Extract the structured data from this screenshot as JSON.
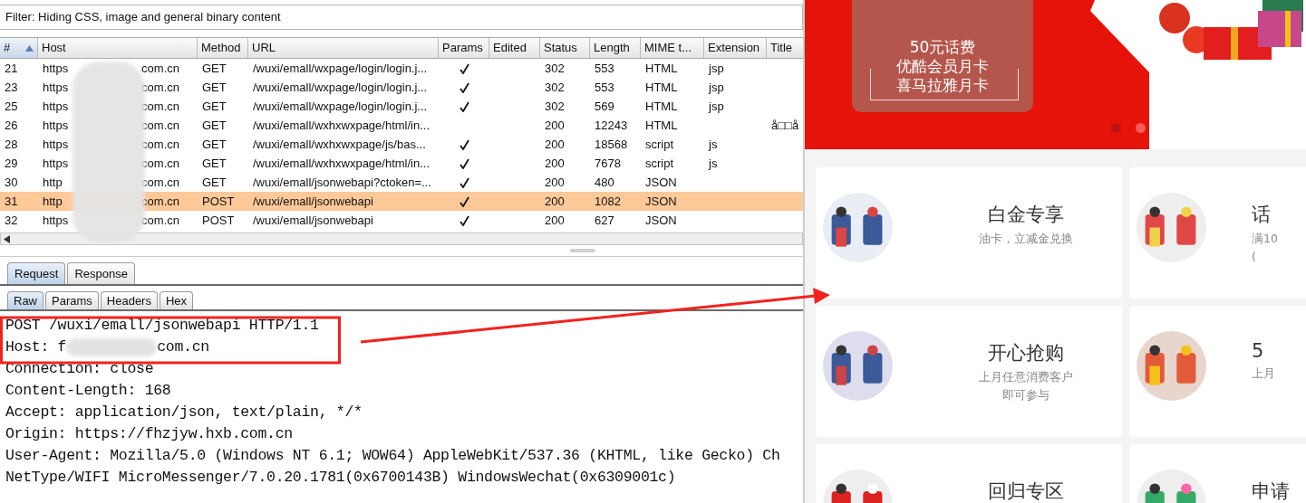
{
  "filter": "Filter: Hiding CSS, image and general binary content",
  "table": {
    "columns": [
      {
        "label": "#",
        "sorted": true
      },
      {
        "label": "Host",
        "sorted": false
      },
      {
        "label": "Method",
        "sorted": false
      },
      {
        "label": "URL",
        "sorted": false
      },
      {
        "label": "Params",
        "sorted": false
      },
      {
        "label": "Edited",
        "sorted": false
      },
      {
        "label": "Status",
        "sorted": false
      },
      {
        "label": "Length",
        "sorted": false
      },
      {
        "label": "MIME t...",
        "sorted": false
      },
      {
        "label": "Extension",
        "sorted": false
      },
      {
        "label": "Title",
        "sorted": false
      }
    ],
    "rows": [
      {
        "num": "21",
        "host_start": "https",
        "host_end": "com.cn",
        "method": "GET",
        "url": "/wuxi/emall/wxpage/login/login.j...",
        "params": true,
        "status": "302",
        "length": "553",
        "mime": "HTML",
        "ext": "jsp",
        "title": "",
        "selected": false
      },
      {
        "num": "23",
        "host_start": "https",
        "host_end": "com.cn",
        "method": "GET",
        "url": "/wuxi/emall/wxpage/login/login.j...",
        "params": true,
        "status": "302",
        "length": "553",
        "mime": "HTML",
        "ext": "jsp",
        "title": "",
        "selected": false
      },
      {
        "num": "25",
        "host_start": "https",
        "host_end": "com.cn",
        "method": "GET",
        "url": "/wuxi/emall/wxpage/login/login.j...",
        "params": true,
        "status": "302",
        "length": "569",
        "mime": "HTML",
        "ext": "jsp",
        "title": "",
        "selected": false
      },
      {
        "num": "26",
        "host_start": "https",
        "host_end": "com.cn",
        "method": "GET",
        "url": "/wuxi/emall/wxhxwxpage/html/in...",
        "params": false,
        "status": "200",
        "length": "12243",
        "mime": "HTML",
        "ext": "",
        "title": "å□□å",
        "selected": false
      },
      {
        "num": "28",
        "host_start": "https",
        "host_end": "com.cn",
        "method": "GET",
        "url": "/wuxi/emall/wxhxwxpage/js/bas...",
        "params": true,
        "status": "200",
        "length": "18568",
        "mime": "script",
        "ext": "js",
        "title": "",
        "selected": false
      },
      {
        "num": "29",
        "host_start": "https",
        "host_end": "com.cn",
        "method": "GET",
        "url": "/wuxi/emall/wxhxwxpage/html/in...",
        "params": true,
        "status": "200",
        "length": "7678",
        "mime": "script",
        "ext": "js",
        "title": "",
        "selected": false
      },
      {
        "num": "30",
        "host_start": "http",
        "host_end": "com.cn",
        "method": "GET",
        "url": "/wuxi/emall/jsonwebapi?ctoken=...",
        "params": true,
        "status": "200",
        "length": "480",
        "mime": "JSON",
        "ext": "",
        "title": "",
        "selected": false
      },
      {
        "num": "31",
        "host_start": "http",
        "host_end": "com.cn",
        "method": "POST",
        "url": "/wuxi/emall/jsonwebapi",
        "params": true,
        "status": "200",
        "length": "1082",
        "mime": "JSON",
        "ext": "",
        "title": "",
        "selected": true
      },
      {
        "num": "32",
        "host_start": "https",
        "host_end": "com.cn",
        "method": "POST",
        "url": "/wuxi/emall/jsonwebapi",
        "params": true,
        "status": "200",
        "length": "627",
        "mime": "JSON",
        "ext": "",
        "title": "",
        "selected": false
      }
    ]
  },
  "tabs": [
    {
      "label": "Request",
      "selected": true
    },
    {
      "label": "Response",
      "selected": false
    }
  ],
  "subtabs": [
    {
      "label": "Raw",
      "selected": true
    },
    {
      "label": "Params",
      "selected": false
    },
    {
      "label": "Headers",
      "selected": false
    },
    {
      "label": "Hex",
      "selected": false
    }
  ],
  "raw_lines": [
    {
      "kind": "plain",
      "text": "POST /wuxi/emall/jsonwebapi HTTP/1.1"
    },
    {
      "kind": "redacted",
      "text": "Host: f",
      "end": "com.cn"
    },
    {
      "kind": "plain",
      "text": "Connection: close"
    },
    {
      "kind": "plain",
      "text": "Content-Length: 168"
    },
    {
      "kind": "plain",
      "text": "Accept: application/json, text/plain, */*"
    },
    {
      "kind": "plain",
      "text": "Origin: https://fhzjyw.hxb.com.cn"
    },
    {
      "kind": "plain",
      "text": "User-Agent: Mozilla/5.0 (Windows NT 6.1; WOW64) AppleWebKit/537.36 (KHTML, like Gecko) Ch"
    },
    {
      "kind": "plain",
      "text": "NetType/WIFI MicroMessenger/7.0.20.1781(0x6700143B) WindowsWechat(0x6309001c)"
    }
  ],
  "banner": {
    "lines": [
      "50元话费",
      "优酷会员月卡",
      "喜马拉雅月卡"
    ],
    "dots": [
      {
        "selected": true
      },
      {
        "selected": false
      }
    ]
  },
  "cards": [
    {
      "title": "白金专享",
      "lines": [
        "油卡，立减金兑换"
      ]
    },
    {
      "title": "话",
      "lines": [
        "满10",
        "("
      ]
    },
    {
      "title": "开心抢购",
      "lines": [
        "上月任意消费客户",
        "即可参与"
      ]
    },
    {
      "title": "5",
      "lines": [
        "上月"
      ]
    },
    {
      "title": "回归专区"
    },
    {
      "title": "申请"
    }
  ]
}
